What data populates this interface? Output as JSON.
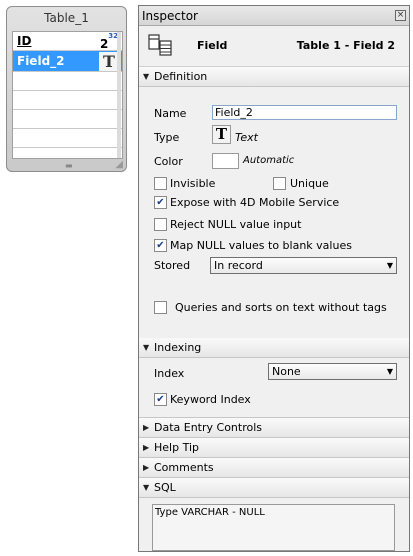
{
  "table": {
    "title": "Table_1",
    "fields": [
      {
        "name": "ID",
        "type_icon": "integer-icon",
        "type_glyph": "2",
        "type_sup": "32"
      },
      {
        "name": "Field_2",
        "type_icon": "text-type-icon",
        "type_glyph": "T"
      }
    ]
  },
  "inspector": {
    "title": "Inspector",
    "close_glyph": "×",
    "header": {
      "field": "Field",
      "path": "Table 1 - Field 2"
    },
    "sections": {
      "definition": "Definition",
      "indexing": "Indexing",
      "data_entry": "Data Entry Controls",
      "help_tip": "Help Tip",
      "comments": "Comments",
      "sql": "SQL"
    },
    "definition": {
      "name_label": "Name",
      "name_value": "Field_2",
      "type_label": "Type",
      "type_glyph": "T",
      "type_value": "Text",
      "color_label": "Color",
      "color_value": "Automatic",
      "invisible": "Invisible",
      "unique": "Unique",
      "expose": "Expose with 4D Mobile Service",
      "reject_null": "Reject NULL value input",
      "map_null": "Map NULL values to blank values",
      "stored_label": "Stored",
      "stored_value": "In record",
      "queries": "Queries and sorts on text without tags"
    },
    "indexing": {
      "index_label": "Index",
      "index_value": "None",
      "keyword_index": "Keyword Index"
    },
    "sql": {
      "text": "Type VARCHAR - NULL"
    },
    "checks": {
      "invisible": false,
      "unique": false,
      "expose": true,
      "reject_null": false,
      "map_null": true,
      "queries": false,
      "keyword_index": true
    }
  }
}
